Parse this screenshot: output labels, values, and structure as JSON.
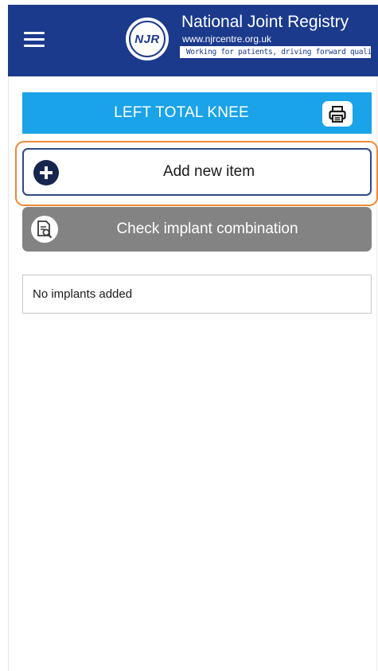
{
  "header": {
    "menu_icon": "hamburger-menu-icon",
    "logo": {
      "badge": "NJR",
      "title": "National Joint Registry",
      "url": "www.njrcentre.org.uk",
      "tagline": "Working for patients, driving forward quality"
    },
    "background_color": "#1b3a8c"
  },
  "procedure": {
    "title": "LEFT TOTAL KNEE",
    "print_icon": "printer-icon",
    "background_color": "#1aa3e8"
  },
  "actions": {
    "add_label": "Add new item",
    "add_icon": "plus-circle-icon",
    "check_label": "Check implant combination",
    "check_icon": "document-search-icon",
    "focus_color": "#f0883a"
  },
  "implants": {
    "empty_text": "No implants added"
  }
}
